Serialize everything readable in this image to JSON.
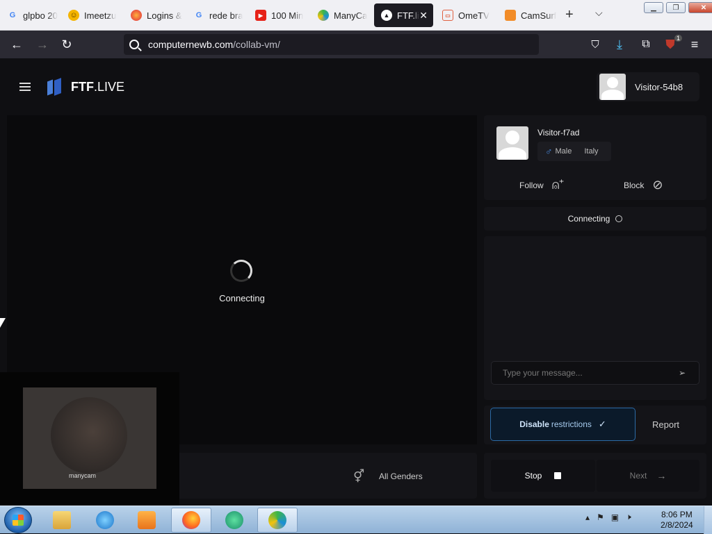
{
  "browser": {
    "tabs": [
      {
        "label": "glpbo 20",
        "favicon": "google-icon",
        "active": false
      },
      {
        "label": "Imeetzu",
        "favicon": "emoji-icon",
        "active": false
      },
      {
        "label": "Logins &",
        "favicon": "firefox-icon",
        "active": false
      },
      {
        "label": "rede bra",
        "favicon": "google-icon",
        "active": false
      },
      {
        "label": "100 Min",
        "favicon": "youtube-icon",
        "active": false
      },
      {
        "label": "ManyCa",
        "favicon": "manycam-icon",
        "active": false
      },
      {
        "label": "FTF.li",
        "favicon": "ftf-icon",
        "active": true
      },
      {
        "label": "OmeTV",
        "favicon": "ometv-icon",
        "active": false
      },
      {
        "label": "CamSurf",
        "favicon": "camsurf-icon",
        "active": false
      }
    ],
    "url_host": "computernewb.com",
    "url_path": "/collab-vm/",
    "extension_badge": "1"
  },
  "site": {
    "logo_bold": "FTF",
    "logo_light": ".LIVE",
    "current_user": "Visitor-54b8"
  },
  "video": {
    "connecting_label": "Connecting",
    "gender_filter": "All Genders",
    "self_watermark": "manycam"
  },
  "partner": {
    "name": "Visitor-f7ad",
    "gender": "Male",
    "country": "Italy",
    "follow_label": "Follow",
    "block_label": "Block"
  },
  "chat": {
    "status": "Connecting",
    "input_placeholder": "Type your message..."
  },
  "controls": {
    "disable_bold": "Disable",
    "disable_rest": "restrictions",
    "report_label": "Report",
    "stop_label": "Stop",
    "next_label": "Next"
  },
  "taskbar": {
    "time": "8:06 PM",
    "date": "2/8/2024"
  },
  "colors": {
    "accent_blue": "#2c6aa6",
    "page_bg": "#0f0f12",
    "male_blue": "#4a8fe8"
  }
}
